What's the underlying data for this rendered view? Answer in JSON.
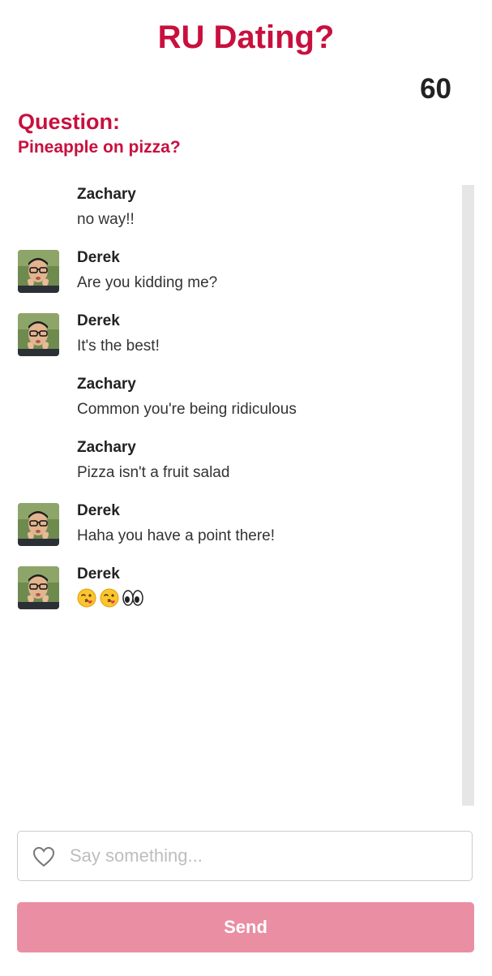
{
  "app": {
    "title": "RU Dating?",
    "timer": "60"
  },
  "question": {
    "heading": "Question:",
    "text": "Pineapple on pizza?"
  },
  "messages": [
    {
      "author": "Zachary",
      "text": "no way!!",
      "has_avatar": false
    },
    {
      "author": "Derek",
      "text": "Are you kidding me?",
      "has_avatar": true
    },
    {
      "author": "Derek",
      "text": "It's the best!",
      "has_avatar": true
    },
    {
      "author": "Zachary",
      "text": "Common you're being ridiculous",
      "has_avatar": false
    },
    {
      "author": "Zachary",
      "text": "Pizza isn't a fruit salad",
      "has_avatar": false
    },
    {
      "author": "Derek",
      "text": "Haha you have a point there!",
      "has_avatar": true
    },
    {
      "author": "Derek",
      "text": "",
      "emoji": [
        "face-blowing-kiss-emoji",
        "face-blowing-kiss-emoji",
        "eyes-emoji"
      ],
      "has_avatar": true
    }
  ],
  "composer": {
    "placeholder": "Say something...",
    "value": "",
    "icon": "heart-icon",
    "send_label": "Send"
  },
  "colors": {
    "brand": "#c8103e",
    "send_button": "#e98ea3",
    "scroll_track": "#e6e6e6"
  }
}
